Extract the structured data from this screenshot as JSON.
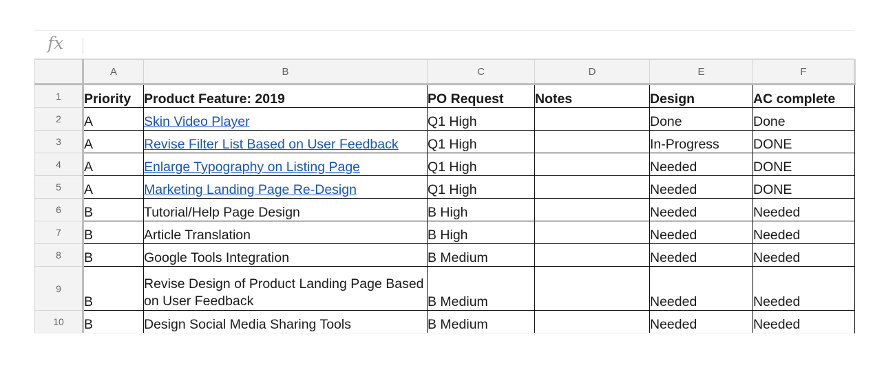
{
  "formula_bar": {
    "icon": "fx",
    "value": ""
  },
  "columns": [
    "A",
    "B",
    "C",
    "D",
    "E",
    "F"
  ],
  "rows": [
    {
      "n": "1",
      "priority": "Priority",
      "feature": "Product Feature: 2019",
      "po": "PO Request",
      "notes": "Notes",
      "design": "Design",
      "ac": "AC complete"
    },
    {
      "n": "2",
      "priority": "A",
      "feature": "Skin Video Player",
      "po": "Q1 High",
      "notes": "",
      "design": "Done",
      "ac": "Done"
    },
    {
      "n": "3",
      "priority": "A",
      "feature": "Revise Filter List Based on User Feedback",
      "po": "Q1 High",
      "notes": "",
      "design": "In-Progress",
      "ac": "DONE"
    },
    {
      "n": "4",
      "priority": "A",
      "feature": "Enlarge Typography on Listing Page",
      "po": "Q1 High",
      "notes": "",
      "design": "Needed",
      "ac": "DONE"
    },
    {
      "n": "5",
      "priority": "A",
      "feature": "Marketing Landing Page Re-Design",
      "po": "Q1 High",
      "notes": "",
      "design": "Needed",
      "ac": "DONE"
    },
    {
      "n": "6",
      "priority": "B",
      "feature": "Tutorial/Help Page Design",
      "po": "B High",
      "notes": "",
      "design": "Needed",
      "ac": "Needed"
    },
    {
      "n": "7",
      "priority": "B",
      "feature": "Article Translation",
      "po": "B High",
      "notes": "",
      "design": "Needed",
      "ac": "Needed"
    },
    {
      "n": "8",
      "priority": "B",
      "feature": "Google Tools Integration",
      "po": "B Medium",
      "notes": "",
      "design": "Needed",
      "ac": "Needed"
    },
    {
      "n": "9",
      "priority": "B",
      "feature": "Revise Design of Product Landing Page Based on User Feedback",
      "po": "B Medium",
      "notes": "",
      "design": "Needed",
      "ac": "Needed"
    },
    {
      "n": "10",
      "priority": "B",
      "feature": "Design Social Media Sharing Tools",
      "po": "B Medium",
      "notes": "",
      "design": "Needed",
      "ac": "Needed"
    }
  ],
  "colors": {
    "link": "#1155cc",
    "header_bg": "#f3f3f3",
    "header_text": "#5f6368",
    "cell_border": "#111111"
  }
}
